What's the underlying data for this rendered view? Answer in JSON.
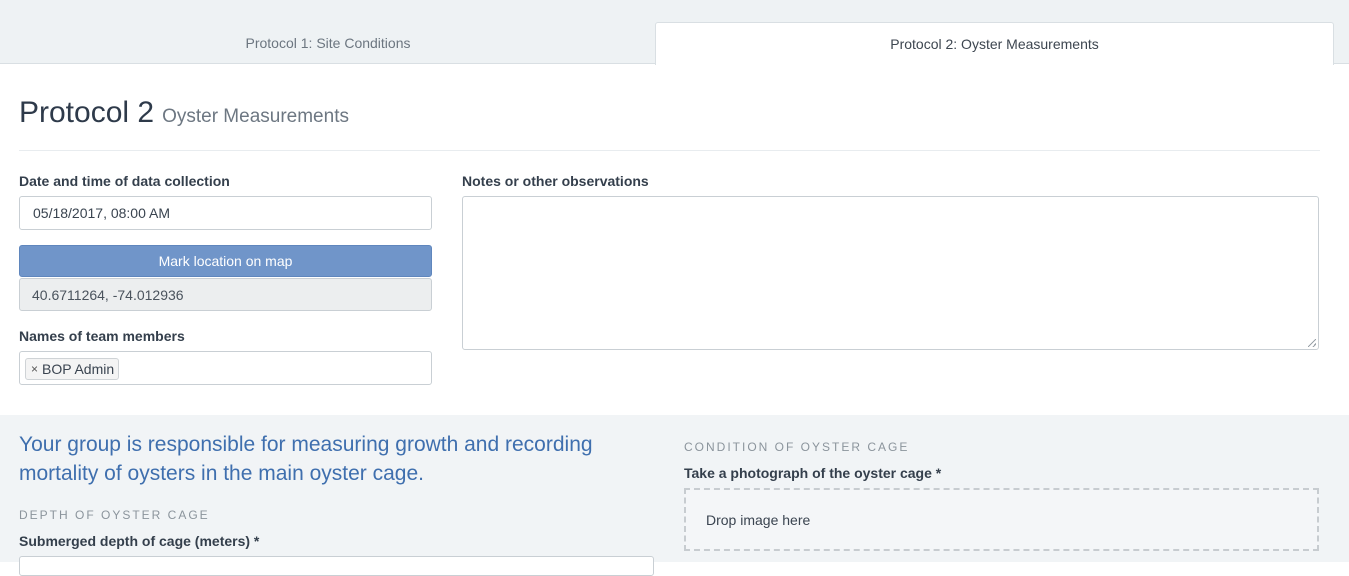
{
  "tabs": [
    {
      "label": "Protocol 1: Site Conditions",
      "active": false
    },
    {
      "label": "Protocol 2: Oyster Measurements",
      "active": true
    }
  ],
  "header": {
    "title": "Protocol 2",
    "subtitle": "Oyster Measurements"
  },
  "form": {
    "datetime_label": "Date and time of data collection",
    "datetime_value": "05/18/2017, 08:00  AM",
    "map_button_label": "Mark location on map",
    "coordinates_value": "40.6711264, -74.012936",
    "team_label": "Names of team members",
    "team_members": [
      {
        "name": "BOP Admin",
        "remove_glyph": "×"
      }
    ],
    "notes_label": "Notes or other observations",
    "notes_value": ""
  },
  "lower": {
    "intro_text": "Your group is responsible for measuring growth and recording mortality of oysters in the main oyster cage.",
    "depth_section_heading": "DEPTH OF OYSTER CAGE",
    "depth_label": "Submerged depth of cage (meters) *",
    "condition_section_heading": "CONDITION OF OYSTER CAGE",
    "photo_label": "Take a photograph of the oyster cage *",
    "dropzone_text": "Drop image here"
  },
  "colors": {
    "accent_button": "#7095c9",
    "intro_text": "#3f6fae",
    "lower_background": "#f1f4f6",
    "tab_bar_background": "#eef2f4"
  },
  "icons": {
    "tag_remove": "close-icon",
    "textarea_resize": "resize-grip-icon"
  }
}
